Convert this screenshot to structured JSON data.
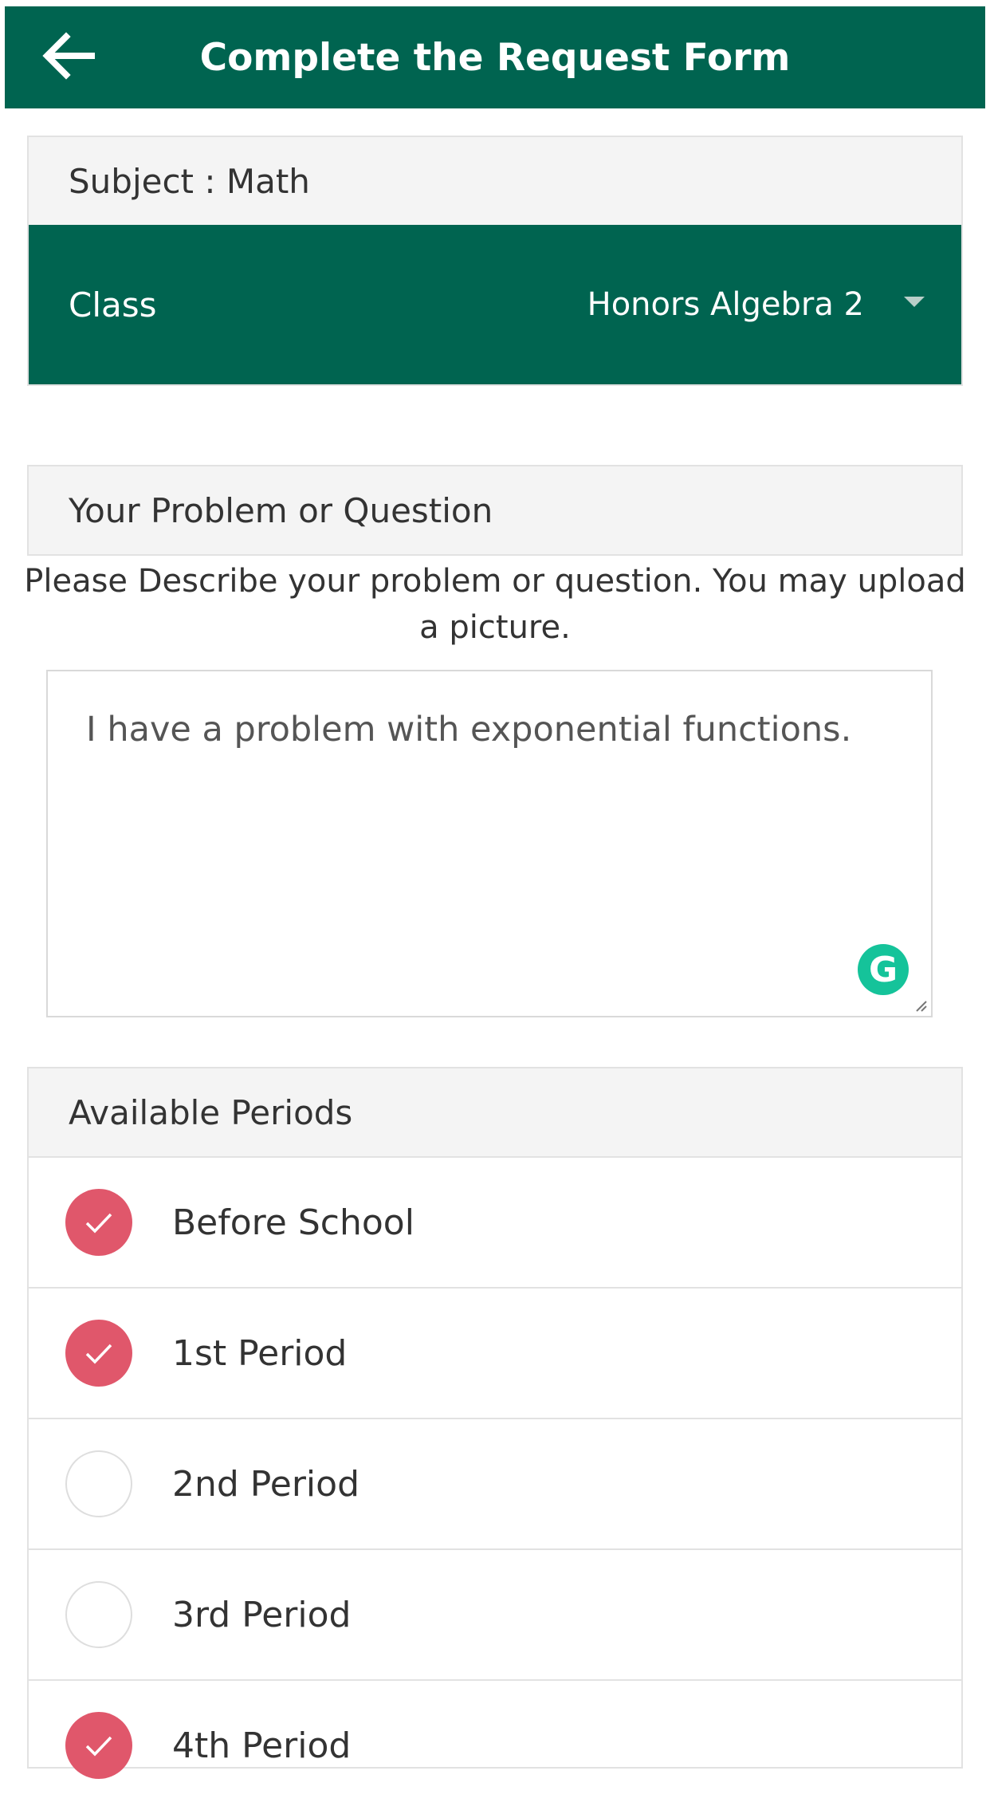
{
  "header": {
    "back_icon": "arrow-left-icon",
    "title": "Complete the Request Form"
  },
  "subject_card": {
    "subject_label": "Subject : Math",
    "class_label": "Class",
    "class_value": "Honors Algebra 2",
    "dropdown_icon": "caret-down-icon"
  },
  "problem_card": {
    "header": "Your Problem or Question",
    "description": "Please Describe your problem or question. You may upload a picture.",
    "textarea_value": "I have a problem with exponential functions.",
    "grammarly_icon": "grammarly-icon"
  },
  "periods_card": {
    "header": "Available Periods",
    "items": [
      {
        "label": "Before School",
        "checked": true
      },
      {
        "label": "1st Period",
        "checked": true
      },
      {
        "label": "2nd Period",
        "checked": false
      },
      {
        "label": "3rd Period",
        "checked": false
      },
      {
        "label": "4th Period",
        "checked": true
      }
    ]
  },
  "colors": {
    "primary": "#006450",
    "checked": "#e0576b",
    "header_bg": "#f4f4f4",
    "grammarly": "#15c39a"
  }
}
